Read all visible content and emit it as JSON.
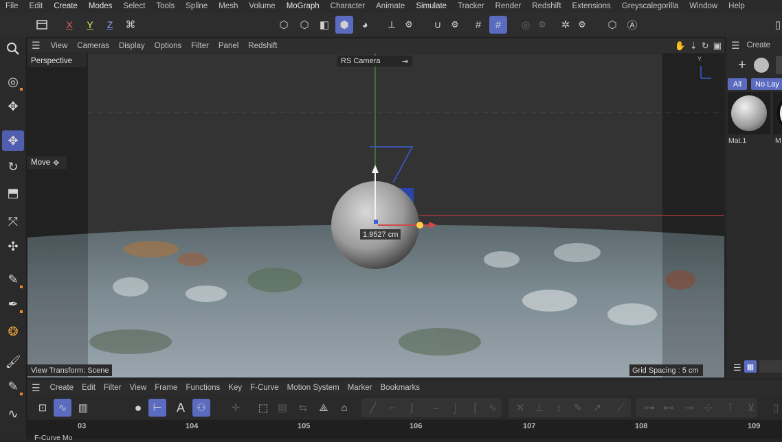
{
  "menu": [
    "File",
    "Edit",
    "Create",
    "Modes",
    "Select",
    "Tools",
    "Spline",
    "Mesh",
    "Volume",
    "MoGraph",
    "Character",
    "Animate",
    "Simulate",
    "Tracker",
    "Render",
    "Redshift",
    "Extensions",
    "Greyscalegorilla",
    "Window",
    "Help"
  ],
  "axis_toggles": {
    "x": "X",
    "y": "Y",
    "z": "Z"
  },
  "viewport": {
    "menu": [
      "View",
      "Cameras",
      "Display",
      "Options",
      "Filter",
      "Panel",
      "Redshift"
    ],
    "camera_name": "Perspective",
    "render_camera": "RS Camera",
    "tool_label": "Move",
    "distance_readout": "1.9527 cm",
    "view_transform": "View Transform: Scene",
    "grid_spacing": "Grid Spacing : 5 cm",
    "axis_y_label": "Y"
  },
  "material_panel": {
    "create": "Create",
    "filter_all": "All",
    "filter_layer": "No Lay",
    "material_name": "Mat.1",
    "material_name_2": "M"
  },
  "fcurve": {
    "menu": [
      "Create",
      "Edit",
      "Filter",
      "View",
      "Frame",
      "Functions",
      "Key",
      "F-Curve",
      "Motion System",
      "Marker",
      "Bookmarks"
    ],
    "text_tool": "A",
    "ruler": [
      "03",
      "104",
      "105",
      "106",
      "107",
      "108",
      "109"
    ],
    "bottom_label": "F-Curve Mo"
  },
  "colors": {
    "accent": "#5b6bbf",
    "x_axis": "#d24a4a",
    "y_axis": "#3cbf3c",
    "z_axis": "#3a5fd8"
  }
}
